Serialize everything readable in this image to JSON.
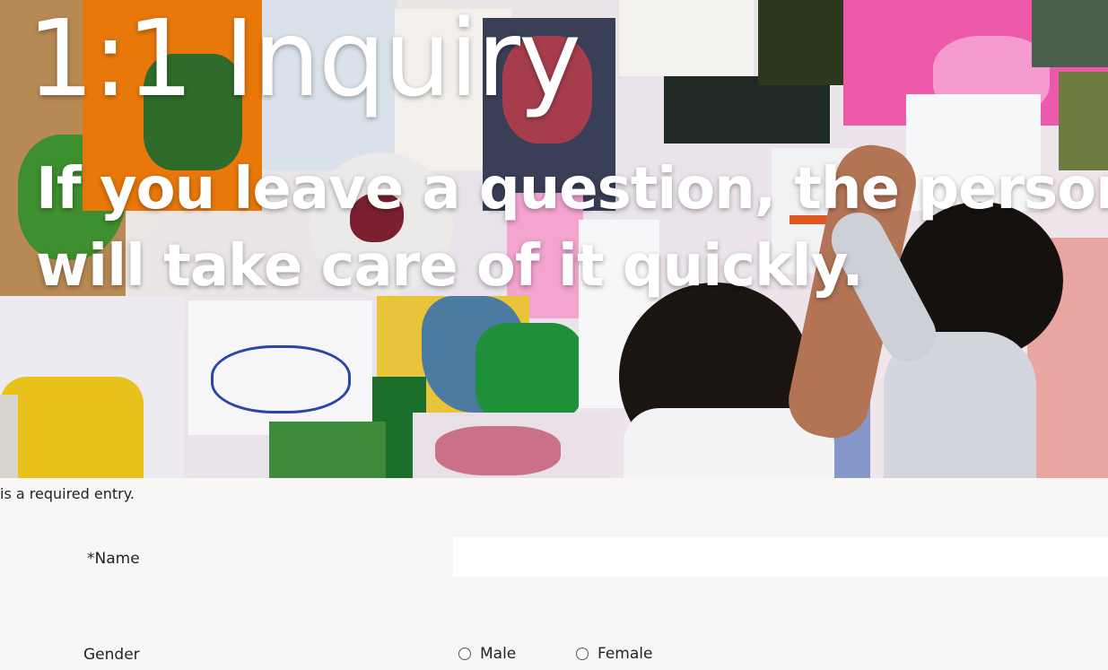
{
  "hero": {
    "title": "1:1 Inquiry",
    "subtitle_line1": "If you leave a question, the person in",
    "subtitle_line2": "will take care of it quickly."
  },
  "form": {
    "required_note": "is a required entry.",
    "name_label": "*Name",
    "name_value": "",
    "gender_label": "Gender",
    "gender_options": [
      "Male",
      "Female"
    ]
  }
}
